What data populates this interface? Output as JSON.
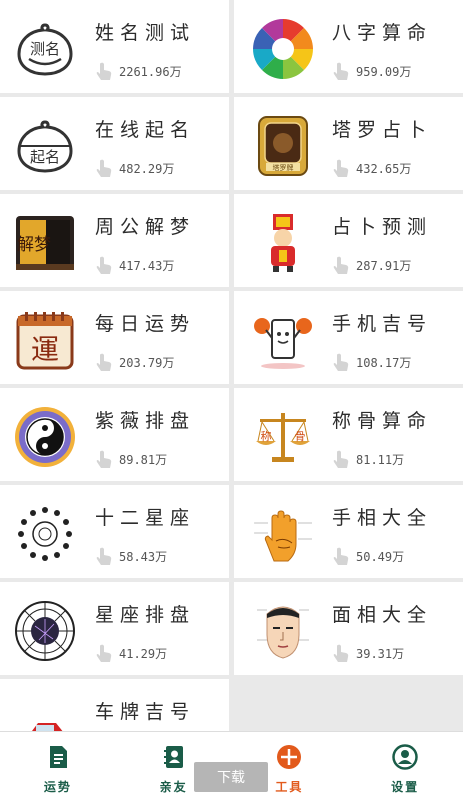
{
  "cards": [
    {
      "title": "姓名测试",
      "stat": "2261.96万",
      "icon": "name-test-icon"
    },
    {
      "title": "八字算命",
      "stat": "959.09万",
      "icon": "bazi-wheel-icon"
    },
    {
      "title": "在线起名",
      "stat": "482.29万",
      "icon": "naming-icon"
    },
    {
      "title": "塔罗占卜",
      "stat": "432.65万",
      "icon": "tarot-icon"
    },
    {
      "title": "周公解梦",
      "stat": "417.43万",
      "icon": "dream-book-icon"
    },
    {
      "title": "占卜预测",
      "stat": "287.91万",
      "icon": "divination-figure-icon"
    },
    {
      "title": "每日运势",
      "stat": "203.79万",
      "icon": "daily-fortune-icon"
    },
    {
      "title": "手机吉号",
      "stat": "108.17万",
      "icon": "phone-number-icon"
    },
    {
      "title": "紫薇排盘",
      "stat": "89.81万",
      "icon": "yin-yang-icon"
    },
    {
      "title": "称骨算命",
      "stat": "81.11万",
      "icon": "scale-icon"
    },
    {
      "title": "十二星座",
      "stat": "58.43万",
      "icon": "zodiac-ring-icon"
    },
    {
      "title": "手相大全",
      "stat": "50.49万",
      "icon": "palm-icon"
    },
    {
      "title": "星座排盘",
      "stat": "41.29万",
      "icon": "astrolabe-icon"
    },
    {
      "title": "面相大全",
      "stat": "39.31万",
      "icon": "face-reading-icon"
    },
    {
      "title": "车牌吉号",
      "stat": "",
      "icon": "car-icon"
    }
  ],
  "icon_texts": {
    "name_test": "测名",
    "naming": "起名",
    "tarot": "塔罗牌",
    "dream": "解梦",
    "daily": "運",
    "scale_left": "称",
    "scale_right": "骨"
  },
  "nav": [
    {
      "label": "运势",
      "icon": "fortune-doc-icon"
    },
    {
      "label": "亲友",
      "icon": "contacts-icon"
    },
    {
      "label": "工具",
      "icon": "tools-icon",
      "active": true
    },
    {
      "label": "设置",
      "icon": "user-settings-icon"
    }
  ],
  "download_label": "下载",
  "colors": {
    "accent": "#e25a1c",
    "nav_green": "#1a5c48",
    "background": "#e9e9e9"
  }
}
